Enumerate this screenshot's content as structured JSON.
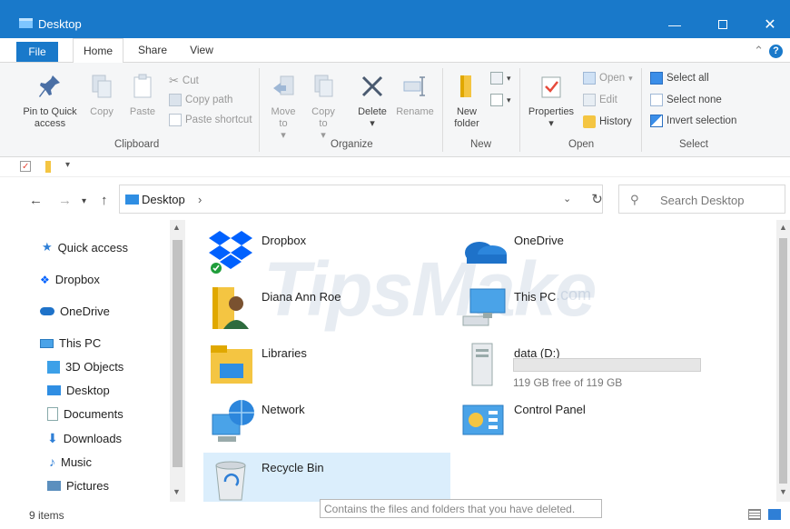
{
  "window": {
    "title": "Desktop"
  },
  "ribbon_tabs": [
    "File",
    "Home",
    "Share",
    "View"
  ],
  "ribbon": {
    "clipboard": {
      "group_label": "Clipboard",
      "pin_label": "Pin to Quick access",
      "copy_label": "Copy",
      "paste_label": "Paste",
      "cut_label": "Cut",
      "copy_path_label": "Copy path",
      "paste_shortcut_label": "Paste shortcut"
    },
    "organize": {
      "group_label": "Organize",
      "move_to_label": "Move to",
      "copy_to_label": "Copy to",
      "delete_label": "Delete",
      "rename_label": "Rename"
    },
    "new": {
      "group_label": "New",
      "new_folder_label": "New folder"
    },
    "open": {
      "group_label": "Open",
      "properties_label": "Properties",
      "open_label": "Open",
      "edit_label": "Edit",
      "history_label": "History"
    },
    "select": {
      "group_label": "Select",
      "select_all_label": "Select all",
      "select_none_label": "Select none",
      "invert_selection_label": "Invert selection"
    }
  },
  "address": {
    "location": "Desktop",
    "search_placeholder": "Search Desktop"
  },
  "nav_pane": {
    "items": [
      "Quick access",
      "Dropbox",
      "OneDrive",
      "This PC",
      "3D Objects",
      "Desktop",
      "Documents",
      "Downloads",
      "Music",
      "Pictures"
    ]
  },
  "content": {
    "items": [
      {
        "name": "Dropbox",
        "icon": "dropbox-icon"
      },
      {
        "name": "OneDrive",
        "icon": "onedrive-icon"
      },
      {
        "name": "Diana Ann Roe",
        "icon": "user-folder-icon"
      },
      {
        "name": "This PC",
        "icon": "computer-icon"
      },
      {
        "name": "Libraries",
        "icon": "libraries-icon"
      },
      {
        "name": "data (D:)",
        "icon": "drive-icon"
      },
      {
        "name": "Network",
        "icon": "network-icon"
      },
      {
        "name": "Control Panel",
        "icon": "control-panel-icon"
      },
      {
        "name": "Recycle Bin",
        "icon": "recycle-bin-icon"
      }
    ],
    "drive_free": "119 GB free of 119 GB",
    "drive_used_fraction": 0.0,
    "watermark": "TipsMake",
    "watermark_suffix": ".com"
  },
  "tooltip": "Contains the files and folders that you have deleted.",
  "status": {
    "count": "9 items"
  },
  "colors": {
    "accent": "#1979ca",
    "selection": "#dbeefc",
    "folder": "#f4c542"
  }
}
